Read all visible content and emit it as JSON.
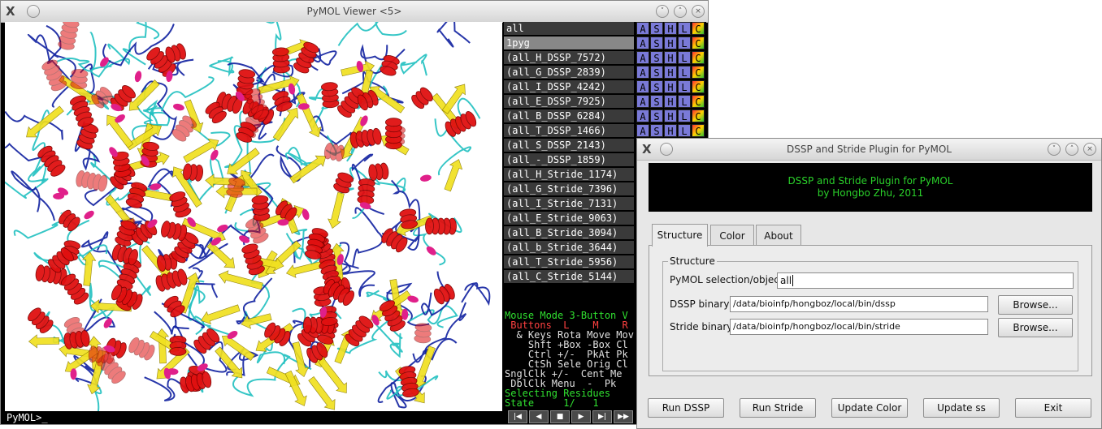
{
  "pymol_window": {
    "title": "PyMOL Viewer <5>",
    "command_prompt": "PyMOL>_",
    "objects": [
      {
        "name": "all",
        "selected": false
      },
      {
        "name": "1pyg",
        "selected": true
      },
      {
        "name": "(all_H_DSSP_7572)"
      },
      {
        "name": "(all_G_DSSP_2839)"
      },
      {
        "name": "(all_I_DSSP_4242)"
      },
      {
        "name": "(all_E_DSSP_7925)"
      },
      {
        "name": "(all_B_DSSP_6284)"
      },
      {
        "name": "(all_T_DSSP_1466)"
      },
      {
        "name": "(all_S_DSSP_2143)"
      },
      {
        "name": "(all_-_DSSP_1859)"
      },
      {
        "name": "(all_H_Stride_1174)"
      },
      {
        "name": "(all_G_Stride_7396)"
      },
      {
        "name": "(all_I_Stride_7131)"
      },
      {
        "name": "(all_E_Stride_9063)"
      },
      {
        "name": "(all_B_Stride_3094)"
      },
      {
        "name": "(all_b_Stride_3644)"
      },
      {
        "name": "(all_T_Stride_5956)"
      },
      {
        "name": "(all_C_Stride_5144)"
      }
    ],
    "object_buttons": [
      "A",
      "S",
      "H",
      "L",
      "C"
    ],
    "mouse_mode": {
      "line1": "Mouse Mode 3-Button V",
      "line2": " Buttons  L    M    R",
      "line3": "  & Keys Rota Move Mov",
      "line4": "    Shft +Box -Box Cl",
      "line5": "    Ctrl +/-  PkAt Pk",
      "line6": "    CtSh Sele Orig Cl",
      "line7": "SnglClk +/-  Cent Me",
      "line8": " DblClk Menu  -  Pk",
      "line9": "Selecting Residues",
      "line10": "State     1/   1"
    },
    "vcr_icons": [
      "rewind-icon",
      "step-back-icon",
      "stop-icon",
      "play-icon",
      "step-forward-icon",
      "fast-forward-icon"
    ]
  },
  "plugin_window": {
    "title": "DSSP and Stride Plugin for PyMOL",
    "banner_line1": "DSSP and Stride Plugin for PyMOL",
    "banner_line2": "by Hongbo Zhu, 2011",
    "tabs": [
      "Structure",
      "Color",
      "About"
    ],
    "active_tab": "Structure",
    "group_label": "Structure",
    "selection_label": "PyMOL selection/object:",
    "selection_value": "all",
    "dssp_label": "DSSP binary:",
    "dssp_value": "/data/bioinfp/hongboz/local/bin/dssp",
    "stride_label": "Stride binary:",
    "stride_value": "/data/bioinfp/hongboz/local/bin/stride",
    "browse_label": "Browse...",
    "buttons": [
      "Run DSSP",
      "Run Stride",
      "Update Color",
      "Update ss",
      "Exit"
    ]
  },
  "colors": {
    "helix": "#e01010",
    "sheet": "#f0e020",
    "loop_cyan": "#20c0c0",
    "loop_blue": "#1020a0",
    "magenta": "#e0208a",
    "banner_text": "#2ad02a"
  }
}
